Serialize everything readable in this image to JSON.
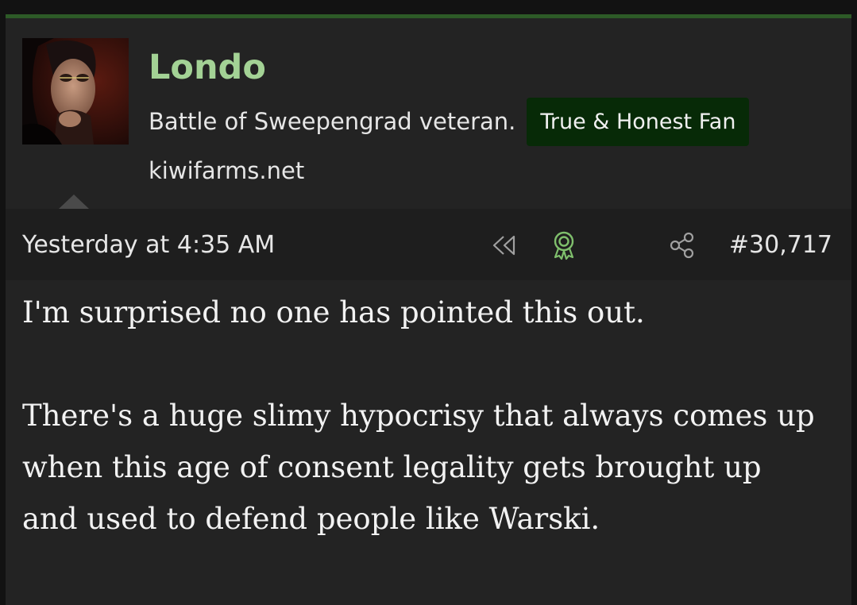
{
  "user": {
    "name": "Londo",
    "title": "Battle of Sweepengrad veteran.",
    "banner": "True & Honest Fan",
    "site": "kiwifarms.net"
  },
  "meta": {
    "timestamp": "Yesterday at 4:35 AM",
    "post_number": "#30,717",
    "icons": [
      "rewind-icon",
      "award-icon",
      "share-icon"
    ]
  },
  "post": {
    "paragraphs": [
      "I'm surprised no one has pointed this out.",
      "There's a huge slimy hypocrisy that always comes up when this age of consent legality gets brought up and used to defend people like Warski."
    ]
  },
  "colors": {
    "accent_border": "#2d5a27",
    "username": "#a3d295",
    "banner_bg": "#072a07",
    "award_icon": "#7fbf6c",
    "background": "#232323"
  }
}
